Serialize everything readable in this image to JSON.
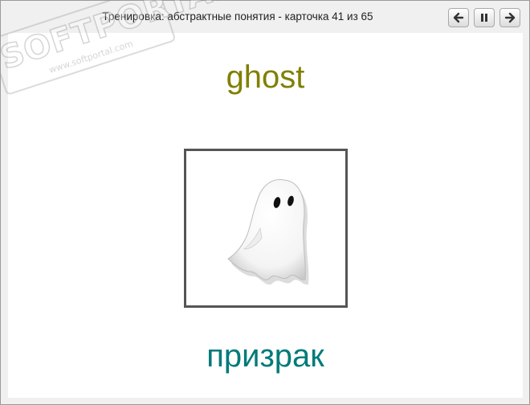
{
  "window": {
    "title": "Тренировка: абстрактные понятия - карточка 41 из 65"
  },
  "controls": {
    "prev_icon": "arrow-left-icon",
    "pause_icon": "pause-icon",
    "next_icon": "arrow-right-icon"
  },
  "card": {
    "word": "ghost",
    "translation": "призрак",
    "picture_icon": "ghost-picture",
    "word_color": "#808000",
    "translation_color": "#007a7a"
  },
  "watermark": {
    "brand": "SOFTPORTAL",
    "url": "www.softportal.com"
  }
}
